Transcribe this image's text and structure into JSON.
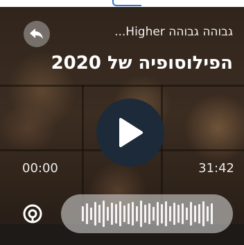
{
  "player": {
    "podcast_name": "גבוהה גבוהה Higher...",
    "episode_title": "הפילוסופיה של 2020",
    "time_elapsed": "00:00",
    "time_total": "31:42",
    "playback_progress": 0,
    "state": "paused"
  },
  "icons": {
    "back": "reply-arrow-icon",
    "play": "play-icon",
    "logo": "podcast-logo-icon",
    "waveform": "waveform-icon"
  },
  "colors": {
    "play_button": "#1d2a39",
    "text": "#ffffff",
    "background_tint": "#3a2c22"
  }
}
